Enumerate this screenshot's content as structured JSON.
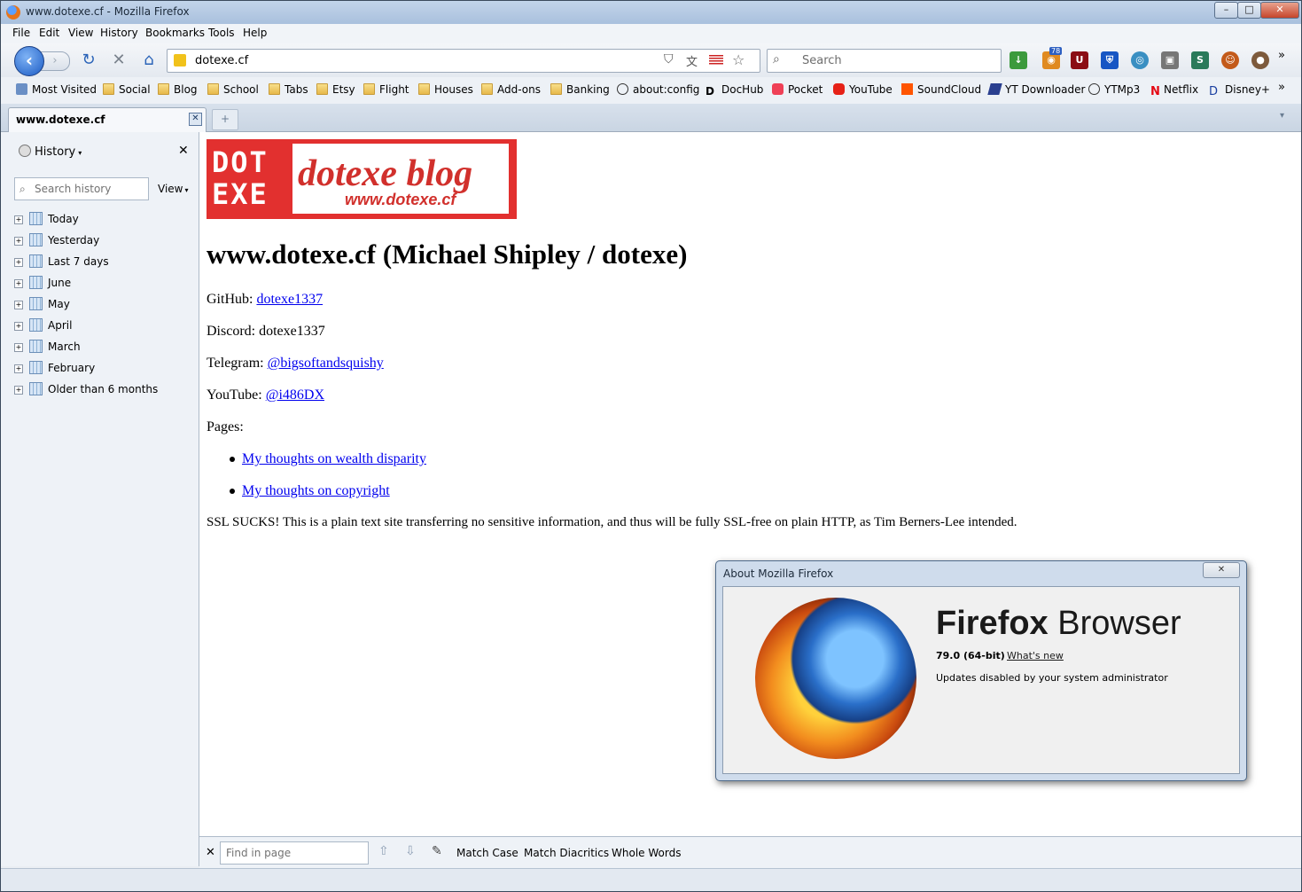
{
  "window": {
    "title": "www.dotexe.cf - Mozilla Firefox"
  },
  "menubar": [
    "File",
    "Edit",
    "View",
    "History",
    "Bookmarks",
    "Tools",
    "Help"
  ],
  "navbar": {
    "url": "dotexe.cf",
    "search_placeholder": "Search",
    "badge_count": "78"
  },
  "bookmarks": [
    "Most Visited",
    "Social",
    "Blog",
    "School",
    "Tabs",
    "Etsy",
    "Flight",
    "Houses",
    "Add-ons",
    "Banking",
    "about:config",
    "DocHub",
    "Pocket",
    "YouTube",
    "SoundCloud",
    "YT Downloader",
    "YTMp3",
    "Netflix",
    "Disney+"
  ],
  "tab": {
    "title": "www.dotexe.cf"
  },
  "sidebar": {
    "title": "History",
    "search_placeholder": "Search history",
    "view_label": "View",
    "items": [
      "Today",
      "Yesterday",
      "Last 7 days",
      "June",
      "May",
      "April",
      "March",
      "February",
      "Older than 6 months"
    ]
  },
  "page": {
    "logo": {
      "mark_line1": "DOT",
      "mark_line2": "EXE",
      "title": "dotexe blog",
      "url": "www.dotexe.cf"
    },
    "heading": "www.dotexe.cf (Michael Shipley / dotexe)",
    "github_label": "GitHub: ",
    "github_link": "dotexe1337",
    "discord": "Discord: dotexe1337",
    "telegram_label": "Telegram: ",
    "telegram_link": "@bigsoftandsquishy",
    "youtube_label": "YouTube: ",
    "youtube_link": "@i486DX",
    "pages_label": "Pages:",
    "pages": [
      "My thoughts on wealth disparity",
      "My thoughts on copyright"
    ],
    "note": "SSL SUCKS! This is a plain text site transferring no sensitive information, and thus will be fully SSL-free on plain HTTP, as Tim Berners-Lee intended."
  },
  "findbar": {
    "placeholder": "Find in page",
    "match_case": "Match Case",
    "match_diacritics": "Match Diacritics",
    "whole_words": "Whole Words"
  },
  "about": {
    "title": "About Mozilla Firefox",
    "name_bold": "Firefox",
    "name_rest": " Browser",
    "version": "79.0 (64-bit)",
    "whats_new": "What's new",
    "update_status": "Updates disabled by your system administrator"
  }
}
